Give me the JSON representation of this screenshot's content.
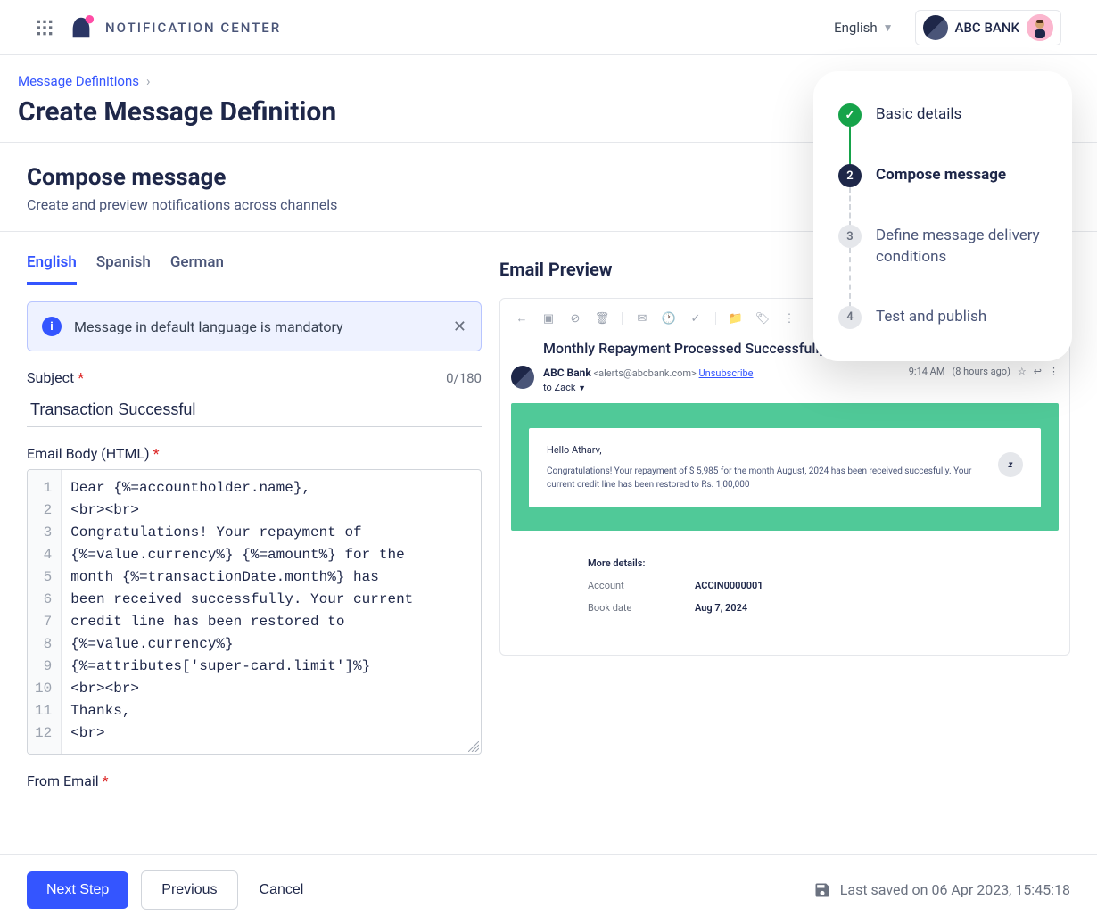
{
  "header": {
    "app_name": "NOTIFICATION CENTER",
    "language": "English",
    "bank_name": "ABC BANK"
  },
  "breadcrumb": {
    "parent": "Message Definitions",
    "title": "Create Message Definition"
  },
  "compose": {
    "title": "Compose message",
    "subtitle": "Create and preview notifications across channels"
  },
  "lang_tabs": [
    "English",
    "Spanish",
    "German"
  ],
  "banner": {
    "text": "Message in default language is mandatory"
  },
  "subject": {
    "label": "Subject",
    "counter": "0/180",
    "value": "Transaction Successful"
  },
  "email_body": {
    "label": "Email Body (HTML)",
    "lines": [
      "Dear {%=accountholder.name},",
      "<br><br>",
      "Congratulations! Your repayment of",
      "{%=value.currency%} {%=amount%} for the",
      "month {%=transactionDate.month%} has",
      "been received successfully. Your current",
      "credit line has been restored to",
      "{%=value.currency%}",
      "{%=attributes['super-card.limit']%}",
      "<br><br>",
      "Thanks,",
      "<br>"
    ]
  },
  "from_email": {
    "label": "From Email"
  },
  "preview": {
    "title": "Email Preview",
    "subject": "Monthly Repayment Processed Successfully",
    "sender_name": "ABC Bank",
    "sender_email": "<alerts@abcbank.com>",
    "unsubscribe": "Unsubscribe",
    "to": "to Zack",
    "time": "9:14 AM",
    "age": "(8 hours ago)",
    "greeting": "Hello Atharv,",
    "body": "Congratulations! Your repayment of $ 5,985 for the month August, 2024 has been received succesfully. Your current credit line has been restored to Rs. 1,00,000",
    "more_label": "More details:",
    "details": [
      {
        "k": "Account",
        "v": "ACCIN0000001"
      },
      {
        "k": "Book date",
        "v": "Aug 7, 2024"
      }
    ]
  },
  "stepper": [
    {
      "label": "Basic details",
      "state": "done"
    },
    {
      "num": "2",
      "label": "Compose message",
      "state": "current"
    },
    {
      "num": "3",
      "label": "Define message delivery conditions",
      "state": "pending"
    },
    {
      "num": "4",
      "label": "Test and publish",
      "state": "pending"
    }
  ],
  "footer": {
    "next": "Next Step",
    "previous": "Previous",
    "cancel": "Cancel",
    "saved": "Last saved on 06 Apr 2023, 15:45:18"
  }
}
